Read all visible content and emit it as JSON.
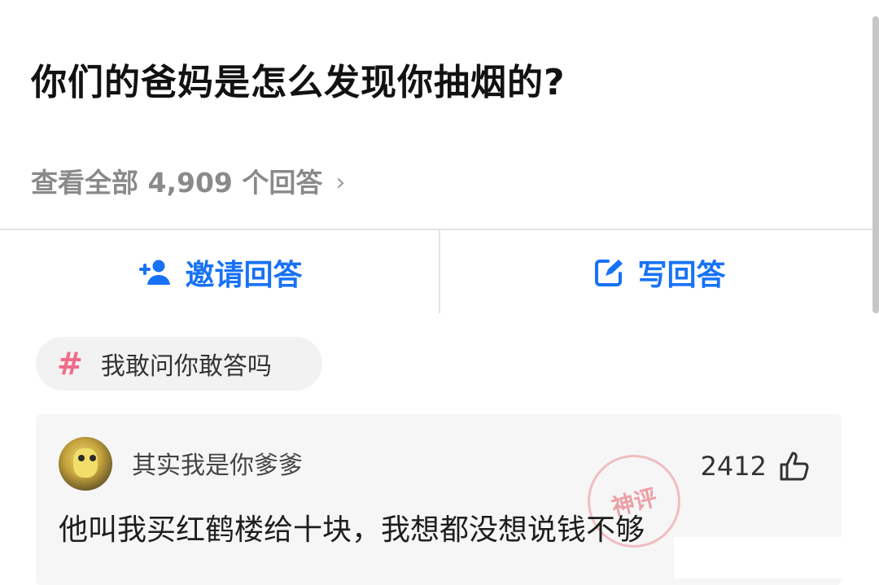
{
  "question": {
    "title": "你们的爸妈是怎么发现你抽烟的?",
    "view_all": "查看全部 4,909 个回答",
    "chevron": "›"
  },
  "actions": {
    "invite_label": "邀请回答",
    "write_label": "写回答"
  },
  "tag": {
    "symbol": "#",
    "label": "我敢问你敢答吗"
  },
  "answer": {
    "username": "其实我是你爹爹",
    "likes": "2412",
    "comment": "他叫我买红鹤楼给十块，我想都没想说钱不够",
    "stamp_text": "神评"
  },
  "colors": {
    "accent": "#1772f6",
    "hash": "#f06c8a"
  }
}
